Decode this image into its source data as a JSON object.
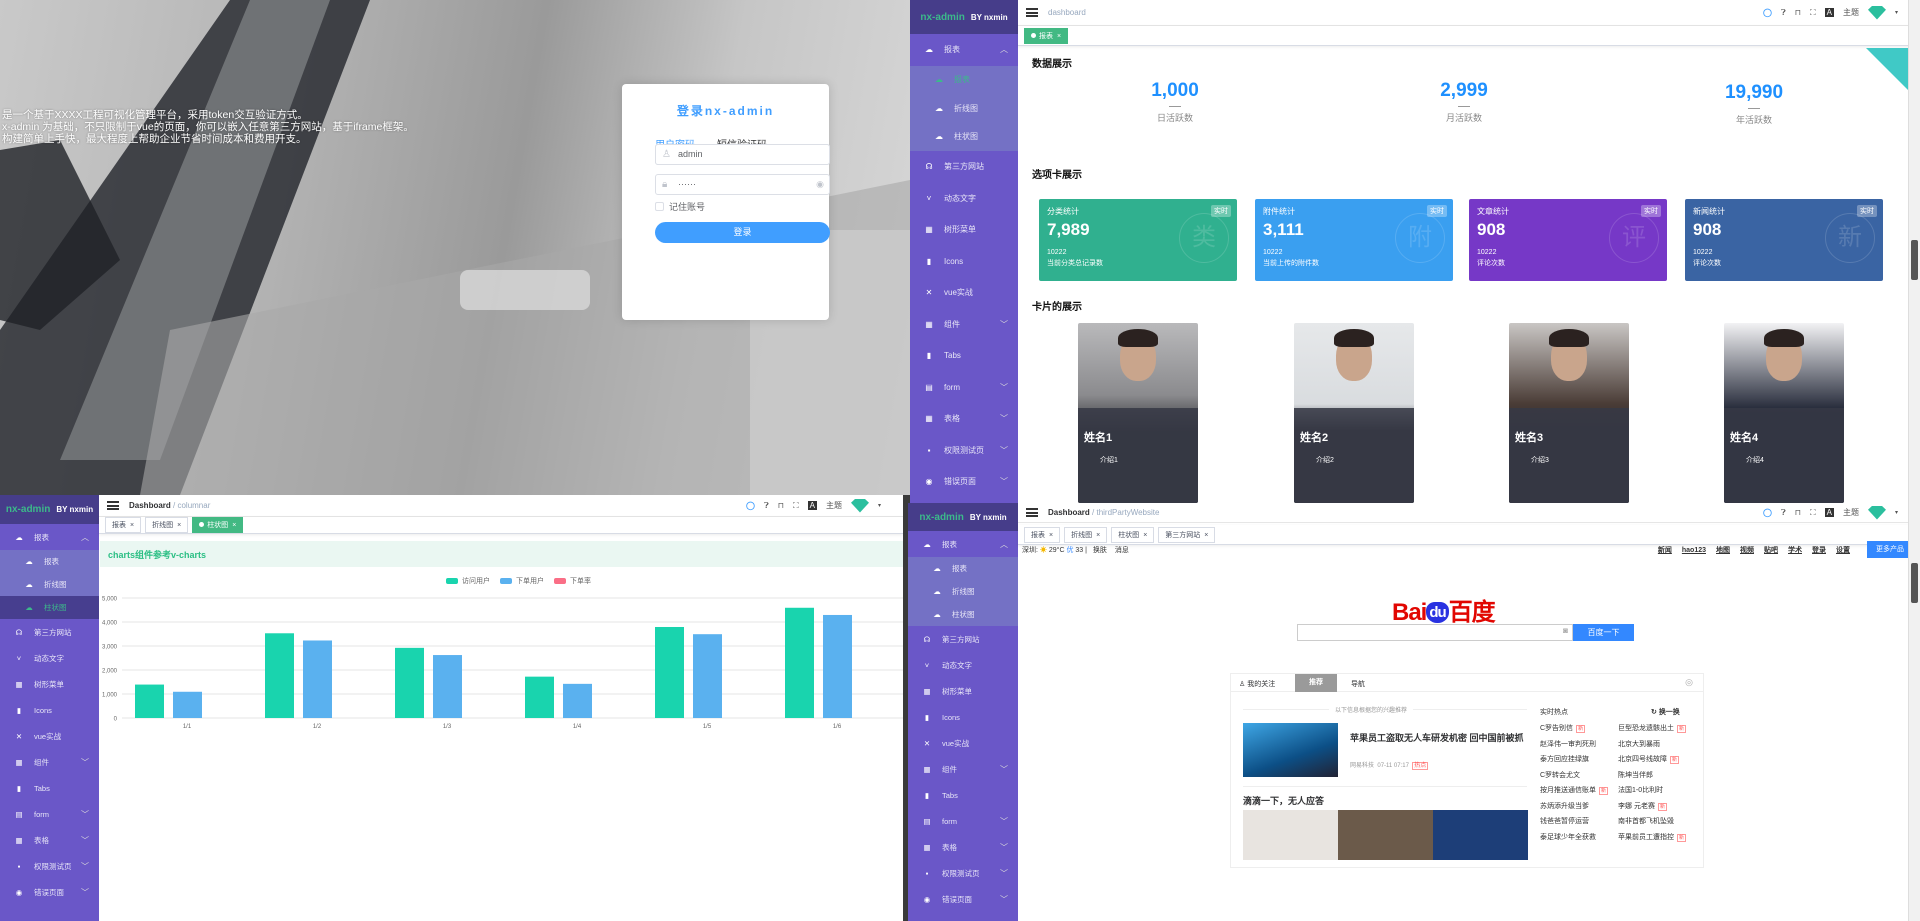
{
  "brand": {
    "name": "nx-admin",
    "by": "BY nxmin"
  },
  "menu": [
    {
      "label": "报表",
      "icon": "dashboard-icon",
      "glyph": "☁",
      "expandable": true,
      "children": [
        {
          "label": "报表",
          "icon": "dashboard-icon",
          "glyph": "☁"
        },
        {
          "label": "折线图",
          "icon": "dashboard-icon",
          "glyph": "☁"
        },
        {
          "label": "柱状图",
          "icon": "dashboard-icon",
          "glyph": "☁"
        }
      ]
    },
    {
      "label": "第三方网站",
      "icon": "website-icon",
      "glyph": "☊",
      "expandable": false
    },
    {
      "label": "动态文字",
      "icon": "chevron-icon",
      "glyph": "˅",
      "expandable": false
    },
    {
      "label": "树形菜单",
      "icon": "grid-icon",
      "glyph": "▦",
      "expandable": false
    },
    {
      "label": "Icons",
      "icon": "icons-icon",
      "glyph": "▮",
      "expandable": false
    },
    {
      "label": "vue实战",
      "icon": "cross-icon",
      "glyph": "✕",
      "expandable": false
    },
    {
      "label": "组件",
      "icon": "grid-icon",
      "glyph": "▦",
      "expandable": true
    },
    {
      "label": "Tabs",
      "icon": "tabs-icon",
      "glyph": "▮",
      "expandable": false
    },
    {
      "label": "form",
      "icon": "form-icon",
      "glyph": "▤",
      "expandable": true
    },
    {
      "label": "表格",
      "icon": "table-icon",
      "glyph": "▦",
      "expandable": true
    },
    {
      "label": "权限测试页",
      "icon": "lock-icon",
      "glyph": "▪",
      "expandable": true
    },
    {
      "label": "错误页面",
      "icon": "error-icon",
      "glyph": "◉",
      "expandable": true
    }
  ],
  "header": {
    "theme_label": "主题",
    "github_icon": "github-icon",
    "help_icon": "question-icon",
    "lock_icon": "lock-icon",
    "fullscreen_icon": "fullscreen-icon",
    "font_icon": "font-size-icon",
    "avatar_icon": "vue-logo-icon"
  },
  "login": {
    "intro_lines": [
      "是一个基于XXXX工程可视化管理平台，采用token交互验证方式。",
      "x-admin 为基础，不只限制于vue的页面，你可以嵌入任意第三方网站，基于iframe框架。",
      "构建简单上手快，最大程度上帮助企业节省时间成本和费用开支。"
    ],
    "title": "登录nx-admin",
    "tabs": [
      "用户密码",
      "短信验证码"
    ],
    "username": "admin",
    "password": "······",
    "remember": "记住账号",
    "submit": "登录"
  },
  "dashboard": {
    "breadcrumb": [
      "dashboard"
    ],
    "tags": [
      {
        "label": "报表",
        "active": true
      }
    ],
    "data_title": "数据展示",
    "stats": [
      {
        "value": "1,000",
        "label": "日活跃数"
      },
      {
        "value": "2,999",
        "label": "月活跃数"
      },
      {
        "value": "19,990",
        "label": "年活跃数"
      }
    ],
    "cards_title": "选项卡展示",
    "cards": [
      {
        "title": "分类统计",
        "badge": "实时",
        "value": "7,989",
        "sub": "10222",
        "desc": "当前分类总记录数",
        "color": "#30b08f",
        "watermark": "类"
      },
      {
        "title": "附件统计",
        "badge": "实时",
        "value": "3,111",
        "sub": "10222",
        "desc": "当前上传的附件数",
        "color": "#3a9ff0",
        "watermark": "附"
      },
      {
        "title": "文章统计",
        "badge": "实时",
        "value": "908",
        "sub": "10222",
        "desc": "评论次数",
        "color": "#7638c7",
        "watermark": "评"
      },
      {
        "title": "新闻统计",
        "badge": "实时",
        "value": "908",
        "sub": "10222",
        "desc": "评论次数",
        "color": "#3a64a3",
        "watermark": "新"
      }
    ],
    "people_title": "卡片的展示",
    "people": [
      {
        "name": "姓名1",
        "intro": "介绍1"
      },
      {
        "name": "姓名2",
        "intro": "介绍2"
      },
      {
        "name": "姓名3",
        "intro": "介绍3"
      },
      {
        "name": "姓名4",
        "intro": "介绍4"
      }
    ]
  },
  "columnar": {
    "breadcrumb": [
      "Dashboard",
      "columnar"
    ],
    "tags": [
      {
        "label": "报表",
        "active": false
      },
      {
        "label": "折线图",
        "active": false
      },
      {
        "label": "柱状图",
        "active": true
      }
    ],
    "banner": "charts组件参考v-charts"
  },
  "chart_data": {
    "type": "bar",
    "categories": [
      "1/1",
      "1/2",
      "1/3",
      "1/4",
      "1/5",
      "1/6"
    ],
    "series": [
      {
        "name": "访问用户",
        "color": "#19d4ae",
        "values": [
          1393,
          3530,
          2923,
          1723,
          3792,
          4593
        ]
      },
      {
        "name": "下单用户",
        "color": "#5ab1ef",
        "values": [
          1093,
          3230,
          2623,
          1423,
          3492,
          4293
        ]
      },
      {
        "name": "下单率",
        "color": "#fa6e86",
        "values": []
      }
    ],
    "yticks": [
      "0",
      "1,000",
      "2,000",
      "3,000",
      "4,000",
      "5,000"
    ],
    "ylim": [
      0,
      5000
    ],
    "grid": true,
    "legend": "top-center"
  },
  "third_party": {
    "breadcrumb": [
      "Dashboard",
      "thirdPartyWebsite"
    ],
    "tags": [
      {
        "label": "报表",
        "active": false
      },
      {
        "label": "折线图",
        "active": false
      },
      {
        "label": "柱状图",
        "active": false
      },
      {
        "label": "第三方网站",
        "active": false
      }
    ],
    "baidu": {
      "city": "深圳:",
      "temp": "29°C",
      "aqi_label": "优",
      "aqi": "33",
      "left_links": [
        "换肤",
        "消息"
      ],
      "nav_links": [
        "新闻",
        "hao123",
        "地图",
        "视频",
        "贴吧",
        "学术",
        "登录",
        "设置"
      ],
      "more": "更多产品",
      "logo_left": "Bai",
      "logo_mid": "du",
      "logo_right": "百度",
      "search_button": "百度一下",
      "feed_tabs": [
        "我的关注",
        "推荐",
        "导航"
      ],
      "feed_hint": "以下信息根据您的兴趣推荐",
      "article_title": "苹果员工盗取无人车研发机密 回中国前被抓",
      "article_source": "网易科技",
      "article_time": "07-11 07:17",
      "article_tag": "热点",
      "article2_title": "滴滴一下，无人应答",
      "hot_title": "实时热点",
      "refresh": "换一换",
      "new_label": "新",
      "hot_items": [
        {
          "text": "C罗告别信",
          "new": true
        },
        {
          "text": "巨型恐龙遗骸出土",
          "new": true
        },
        {
          "text": "赵泽伟一审判死刑",
          "new": false
        },
        {
          "text": "北京大到暴雨",
          "new": false
        },
        {
          "text": "泰方回应挂绿旗",
          "new": false
        },
        {
          "text": "北京四号线故障",
          "new": true
        },
        {
          "text": "C罗转会尤文",
          "new": false
        },
        {
          "text": "陈坤当伴郎",
          "new": false
        },
        {
          "text": "按月推送通信账单",
          "new": true
        },
        {
          "text": "法国1-0比利时",
          "new": false
        },
        {
          "text": "苏炳添升级当爹",
          "new": false
        },
        {
          "text": "李娜 元老赛",
          "new": true
        },
        {
          "text": "钱爸爸暂停运营",
          "new": false
        },
        {
          "text": "南非首都飞机坠毁",
          "new": false
        },
        {
          "text": "泰足球少年全获救",
          "new": false
        },
        {
          "text": "苹果前员工遭指控",
          "new": true
        }
      ]
    }
  }
}
